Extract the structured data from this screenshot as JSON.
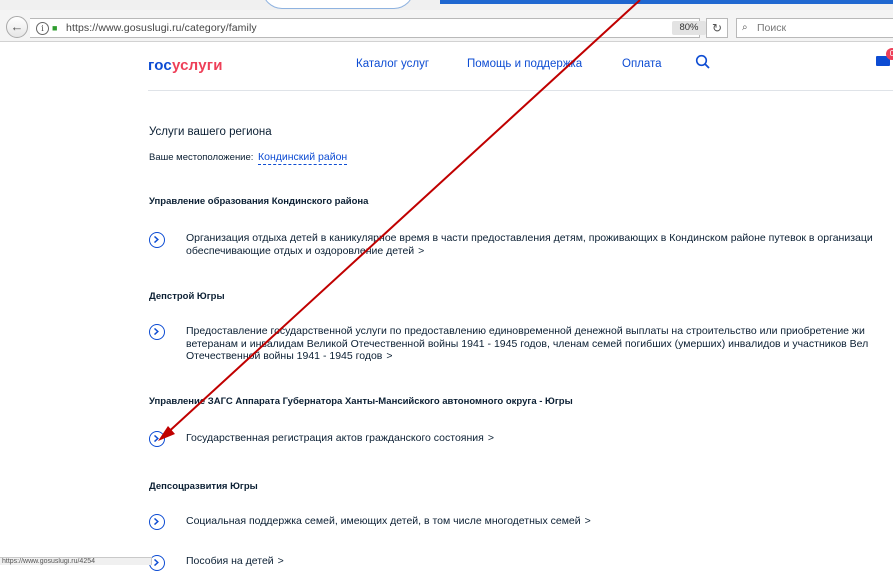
{
  "browser": {
    "url": "https://www.gosuslugi.ru/category/family",
    "zoom": "80%",
    "search_placeholder": "Поиск",
    "status_text": "https://www.gosuslugi.ru/4254"
  },
  "header": {
    "logo_part1": "гос",
    "logo_part2": "услуги",
    "nav": [
      "Каталог услуг",
      "Помощь и поддержка",
      "Оплата"
    ],
    "mail_badge": "0"
  },
  "region": {
    "title": "Услуги вашего региона",
    "location_label": "Ваше местоположение:",
    "location_value": "Кондинский район"
  },
  "sections": [
    {
      "department": "Управление образования Кондинского района",
      "services": [
        {
          "lines": [
            "Организация отдыха детей в каникулярное время в части предоставления детям, проживающих в Кондинском районе путевок в организаци",
            "обеспечивающие отдых и оздоровление детей"
          ]
        }
      ]
    },
    {
      "department": "Депстрой Югры",
      "services": [
        {
          "lines": [
            "Предоставление государственной услуги по предоставлению единовременной денежной выплаты на строительство или приобретение жи",
            "ветеранам и инвалидам Великой Отечественной войны 1941 - 1945 годов, членам семей погибших (умерших) инвалидов и участников Вел",
            "Отечественной войны 1941 - 1945 годов"
          ]
        }
      ]
    },
    {
      "department": "Управление ЗАГС Аппарата Губернатора Ханты-Мансийского автономного округа - Югры",
      "services": [
        {
          "lines": [
            "Государственная регистрация актов гражданского состояния"
          ]
        }
      ]
    },
    {
      "department": "Депсоцразвития Югры",
      "services": [
        {
          "lines": [
            "Социальная поддержка семей, имеющих детей, в том числе многодетных семей"
          ]
        },
        {
          "lines": [
            "Пособия на детей"
          ]
        }
      ]
    }
  ],
  "chevron": ">",
  "colors": {
    "accent": "#0d4cd3",
    "logo_red": "#ee3f58",
    "annotation": "#c00000"
  }
}
